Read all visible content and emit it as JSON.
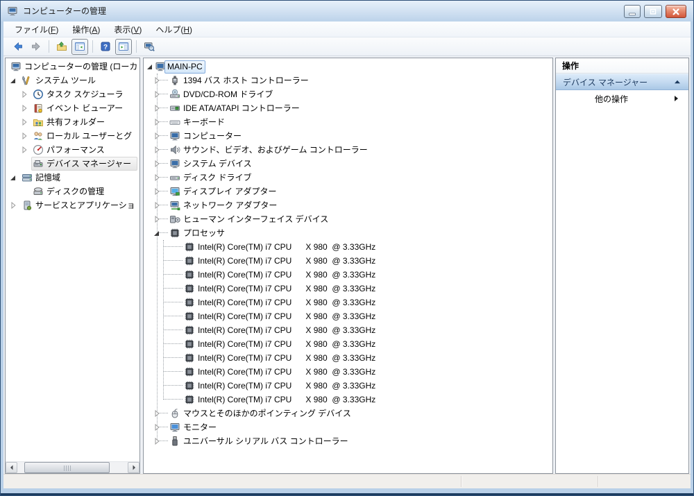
{
  "window": {
    "title": "コンピューターの管理",
    "icon": "computer-management-icon",
    "controls": [
      {
        "name": "minimize-button",
        "glyph": "minimize"
      },
      {
        "name": "restore-button",
        "glyph": "restore"
      },
      {
        "name": "close-button",
        "glyph": "close"
      }
    ]
  },
  "menu_bar": [
    {
      "label": "ファイル",
      "mnemonic": "F"
    },
    {
      "label": "操作",
      "mnemonic": "A"
    },
    {
      "label": "表示",
      "mnemonic": "V"
    },
    {
      "label": "ヘルプ",
      "mnemonic": "H"
    }
  ],
  "toolbar": [
    {
      "type": "button",
      "name": "back-button",
      "icon": "arrow-left-icon"
    },
    {
      "type": "button",
      "name": "forward-button",
      "icon": "arrow-right-icon"
    },
    {
      "type": "separator"
    },
    {
      "type": "button",
      "name": "up-one-level-button",
      "icon": "folder-up-icon"
    },
    {
      "type": "button",
      "name": "console-tree-toggle-button",
      "icon": "console-tree-icon",
      "pressed": true
    },
    {
      "type": "separator"
    },
    {
      "type": "button",
      "name": "help-button",
      "icon": "help-icon"
    },
    {
      "type": "button",
      "name": "action-pane-toggle-button",
      "icon": "action-pane-icon",
      "pressed": true
    },
    {
      "type": "separator"
    },
    {
      "type": "button",
      "name": "scan-hardware-button",
      "icon": "computer-search-icon"
    }
  ],
  "console_tree": {
    "items": [
      {
        "label": "コンピューターの管理 (ローカ",
        "icon": "computer-management-icon",
        "level": 0,
        "expander": "none"
      },
      {
        "label": "システム ツール",
        "icon": "system-tools-icon",
        "level": 1,
        "expander": "expanded"
      },
      {
        "label": "タスク スケジューラ",
        "icon": "task-scheduler-icon",
        "level": 2,
        "expander": "collapsed"
      },
      {
        "label": "イベント ビューアー",
        "icon": "event-viewer-icon",
        "level": 2,
        "expander": "collapsed"
      },
      {
        "label": "共有フォルダー",
        "icon": "shared-folders-icon",
        "level": 2,
        "expander": "collapsed"
      },
      {
        "label": "ローカル ユーザーとグ",
        "icon": "local-users-groups-icon",
        "level": 2,
        "expander": "collapsed"
      },
      {
        "label": "パフォーマンス",
        "icon": "performance-icon",
        "level": 2,
        "expander": "collapsed"
      },
      {
        "label": "デバイス マネージャー",
        "icon": "device-manager-icon",
        "level": 2,
        "expander": "none",
        "selected": true
      },
      {
        "label": "記憶域",
        "icon": "storage-icon",
        "level": 1,
        "expander": "expanded"
      },
      {
        "label": "ディスクの管理",
        "icon": "disk-management-icon",
        "level": 2,
        "expander": "none"
      },
      {
        "label": "サービスとアプリケーショ",
        "icon": "services-applications-icon",
        "level": 1,
        "expander": "collapsed"
      }
    ]
  },
  "device_tree": {
    "items": [
      {
        "label": "MAIN-PC",
        "icon": "computer-icon",
        "level": 0,
        "expander": "expanded",
        "selected": true
      },
      {
        "label": "1394 バス ホスト コントローラー",
        "icon": "firewire-icon",
        "level": 1,
        "expander": "collapsed"
      },
      {
        "label": "DVD/CD-ROM ドライブ",
        "icon": "dvd-drive-icon",
        "level": 1,
        "expander": "collapsed"
      },
      {
        "label": "IDE ATA/ATAPI コントローラー",
        "icon": "ide-controller-icon",
        "level": 1,
        "expander": "collapsed"
      },
      {
        "label": "キーボード",
        "icon": "keyboard-icon",
        "level": 1,
        "expander": "collapsed"
      },
      {
        "label": "コンピューター",
        "icon": "computer-icon",
        "level": 1,
        "expander": "collapsed"
      },
      {
        "label": "サウンド、ビデオ、およびゲーム コントローラー",
        "icon": "sound-video-game-icon",
        "level": 1,
        "expander": "collapsed"
      },
      {
        "label": "システム デバイス",
        "icon": "system-devices-icon",
        "level": 1,
        "expander": "collapsed"
      },
      {
        "label": "ディスク ドライブ",
        "icon": "disk-drive-icon",
        "level": 1,
        "expander": "collapsed"
      },
      {
        "label": "ディスプレイ アダプター",
        "icon": "display-adapter-icon",
        "level": 1,
        "expander": "collapsed"
      },
      {
        "label": "ネットワーク アダプター",
        "icon": "network-adapter-icon",
        "level": 1,
        "expander": "collapsed"
      },
      {
        "label": "ヒューマン インターフェイス デバイス",
        "icon": "hid-icon",
        "level": 1,
        "expander": "collapsed"
      },
      {
        "label": "プロセッサ",
        "icon": "processor-icon",
        "level": 1,
        "expander": "expanded"
      },
      {
        "label": "Intel(R) Core(TM) i7 CPU      X 980  @ 3.33GHz",
        "icon": "processor-icon",
        "level": 2,
        "expander": "none"
      },
      {
        "label": "Intel(R) Core(TM) i7 CPU      X 980  @ 3.33GHz",
        "icon": "processor-icon",
        "level": 2,
        "expander": "none"
      },
      {
        "label": "Intel(R) Core(TM) i7 CPU      X 980  @ 3.33GHz",
        "icon": "processor-icon",
        "level": 2,
        "expander": "none"
      },
      {
        "label": "Intel(R) Core(TM) i7 CPU      X 980  @ 3.33GHz",
        "icon": "processor-icon",
        "level": 2,
        "expander": "none"
      },
      {
        "label": "Intel(R) Core(TM) i7 CPU      X 980  @ 3.33GHz",
        "icon": "processor-icon",
        "level": 2,
        "expander": "none"
      },
      {
        "label": "Intel(R) Core(TM) i7 CPU      X 980  @ 3.33GHz",
        "icon": "processor-icon",
        "level": 2,
        "expander": "none"
      },
      {
        "label": "Intel(R) Core(TM) i7 CPU      X 980  @ 3.33GHz",
        "icon": "processor-icon",
        "level": 2,
        "expander": "none"
      },
      {
        "label": "Intel(R) Core(TM) i7 CPU      X 980  @ 3.33GHz",
        "icon": "processor-icon",
        "level": 2,
        "expander": "none"
      },
      {
        "label": "Intel(R) Core(TM) i7 CPU      X 980  @ 3.33GHz",
        "icon": "processor-icon",
        "level": 2,
        "expander": "none"
      },
      {
        "label": "Intel(R) Core(TM) i7 CPU      X 980  @ 3.33GHz",
        "icon": "processor-icon",
        "level": 2,
        "expander": "none"
      },
      {
        "label": "Intel(R) Core(TM) i7 CPU      X 980  @ 3.33GHz",
        "icon": "processor-icon",
        "level": 2,
        "expander": "none"
      },
      {
        "label": "Intel(R) Core(TM) i7 CPU      X 980  @ 3.33GHz",
        "icon": "processor-icon",
        "level": 2,
        "expander": "none"
      },
      {
        "label": "マウスとそのほかのポインティング デバイス",
        "icon": "mouse-icon",
        "level": 1,
        "expander": "collapsed"
      },
      {
        "label": "モニター",
        "icon": "monitor-icon",
        "level": 1,
        "expander": "collapsed"
      },
      {
        "label": "ユニバーサル シリアル バス コントローラー",
        "icon": "usb-icon",
        "level": 1,
        "expander": "collapsed"
      }
    ]
  },
  "actions_pane": {
    "title": "操作",
    "group": {
      "label": "デバイス マネージャー",
      "icon": "chevron-up-icon"
    },
    "items": [
      {
        "label": "他の操作",
        "icon": "chevron-right-icon"
      }
    ]
  },
  "colors": {
    "titlebar": "#c9dcf0",
    "close_button": "#d2563a",
    "action_header": "#b5d0ec",
    "selection_border": "#84acdd",
    "frame": "#b9d0e8"
  }
}
